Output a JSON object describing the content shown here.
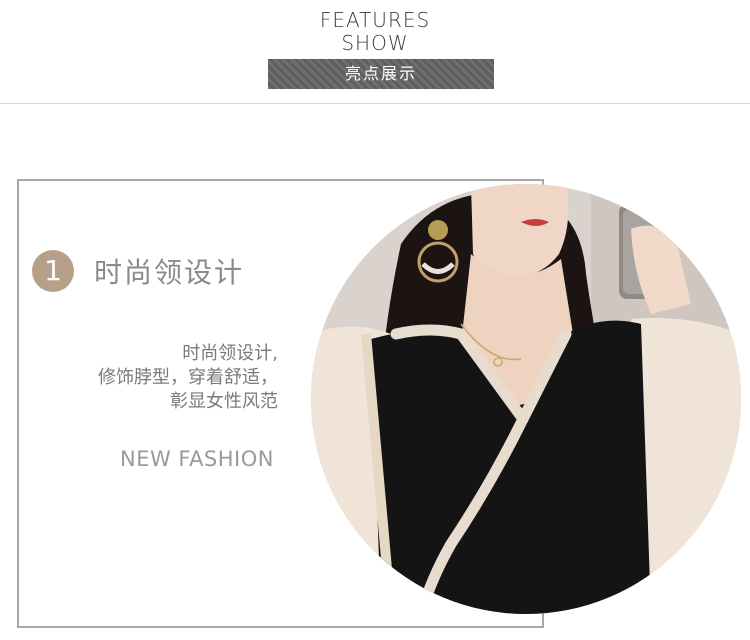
{
  "header": {
    "title_line1": "FEATURES",
    "title_line2": "SHOW",
    "banner_label": "亮点展示"
  },
  "feature": {
    "number": "1",
    "title": "时尚领设计",
    "description_lines": [
      "时尚领设计,",
      "修饰脖型，穿着舒适，",
      "彰显女性风范"
    ],
    "tagline": "NEW FASHION"
  },
  "image": {
    "subject": "model-wearing-black-vneck-dress-with-ruffle-collar"
  },
  "colors": {
    "banner_bg": "#666666",
    "number_circle": "#b7a08a",
    "frame_border": "#a8a8a8",
    "text_gray": "#8a8a8a"
  }
}
